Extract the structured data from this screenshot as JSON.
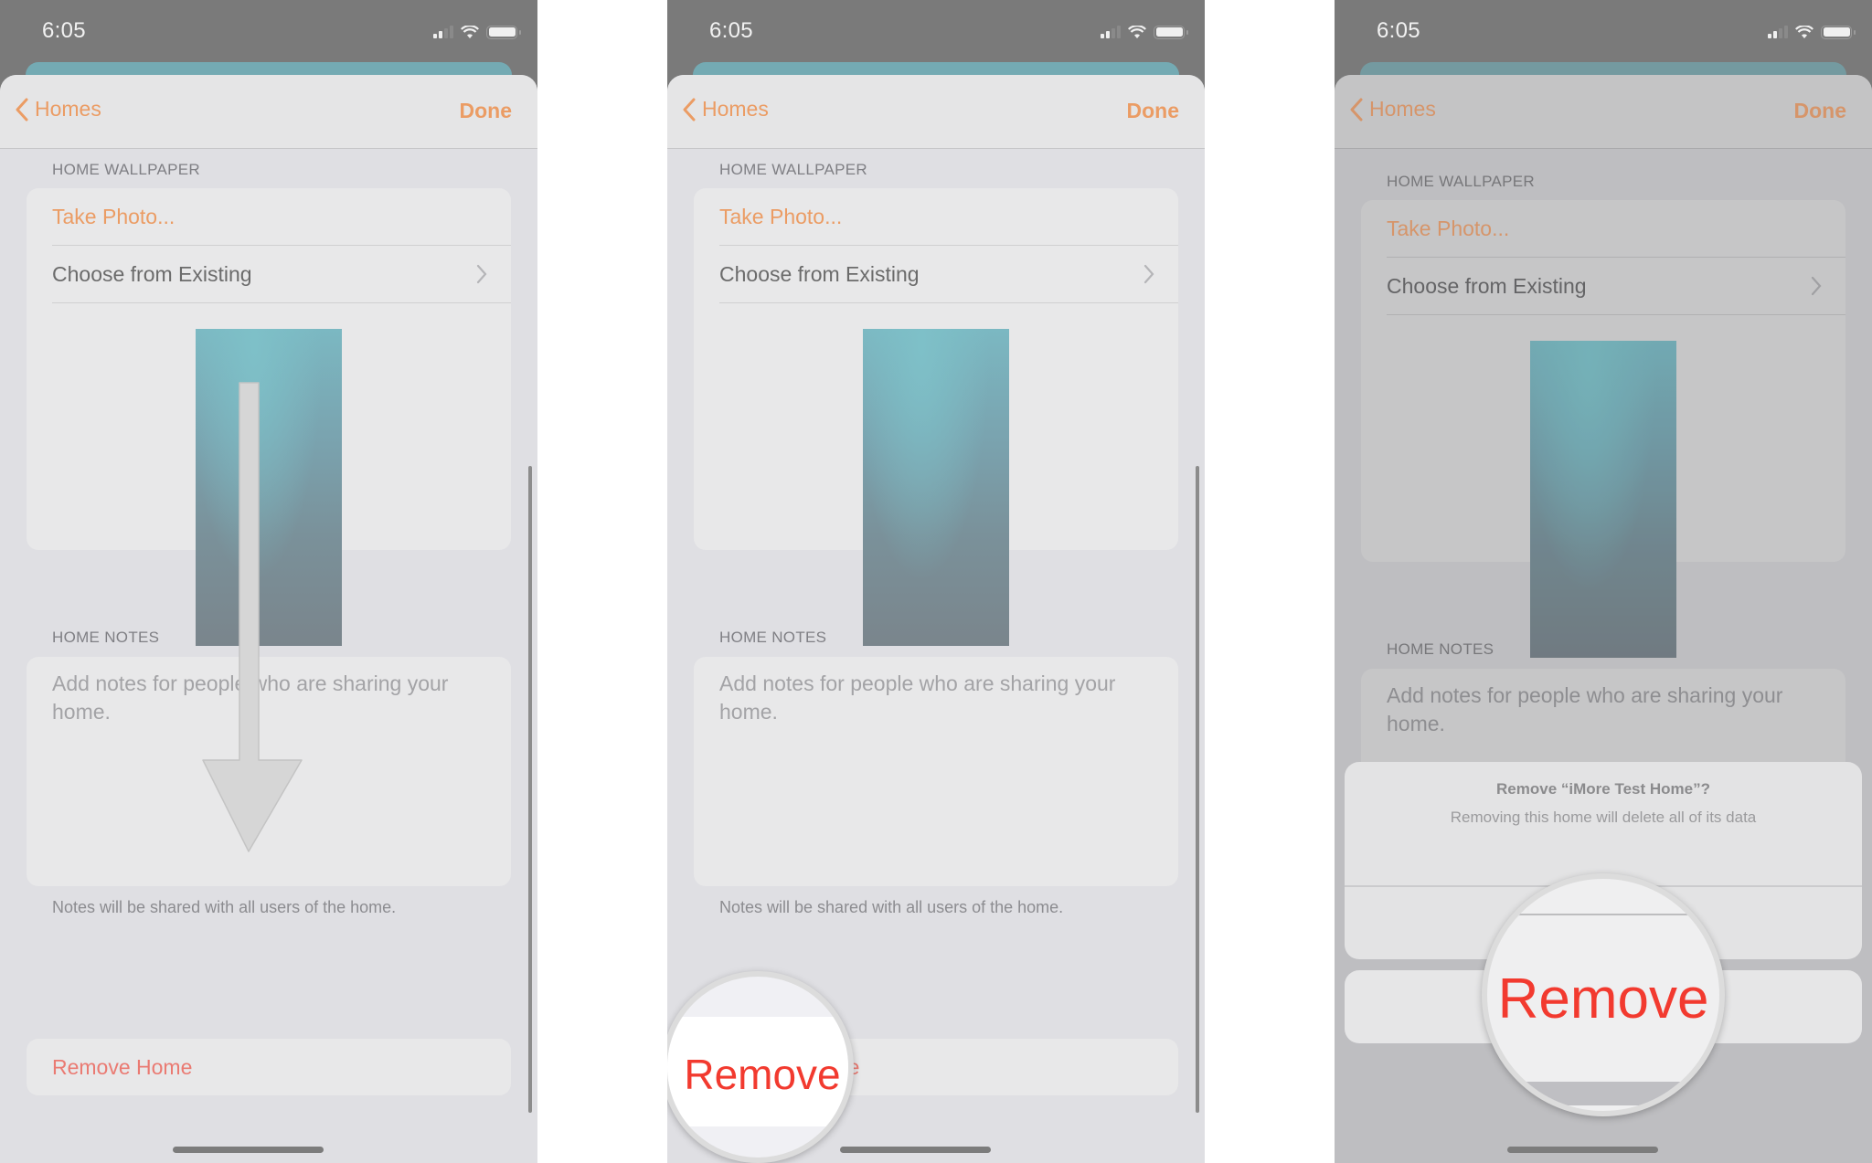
{
  "status_bar": {
    "time": "6:05",
    "icons": [
      "cellular-signal-icon",
      "wifi-icon",
      "battery-icon"
    ]
  },
  "nav": {
    "back_label": "Homes",
    "back_icon": "chevron-left-icon",
    "done_label": "Done"
  },
  "wallpaper_section": {
    "header": "HOME WALLPAPER",
    "take_photo": "Take Photo...",
    "choose_existing": "Choose from Existing",
    "chevron_icon": "chevron-right-icon"
  },
  "notes_section": {
    "header": "HOME NOTES",
    "placeholder": "Add notes for people who are sharing your home.",
    "footer": "Notes will be shared with all users of the home."
  },
  "remove_home_label": "Remove Home",
  "panel1": {
    "annotation": "arrow-down-icon"
  },
  "panel2": {
    "magnifier_label": "Remove"
  },
  "panel3": {
    "action_sheet": {
      "title": "Remove “iMore Test Home”?",
      "message": "Removing this home will delete all of its data",
      "destructive_label": "Remove",
      "cancel_label": ""
    },
    "magnifier_label": "Remove"
  },
  "colors": {
    "accent": "#eb9c64",
    "destructive": "#f23a2f",
    "remove_home": "#ea7a72"
  }
}
